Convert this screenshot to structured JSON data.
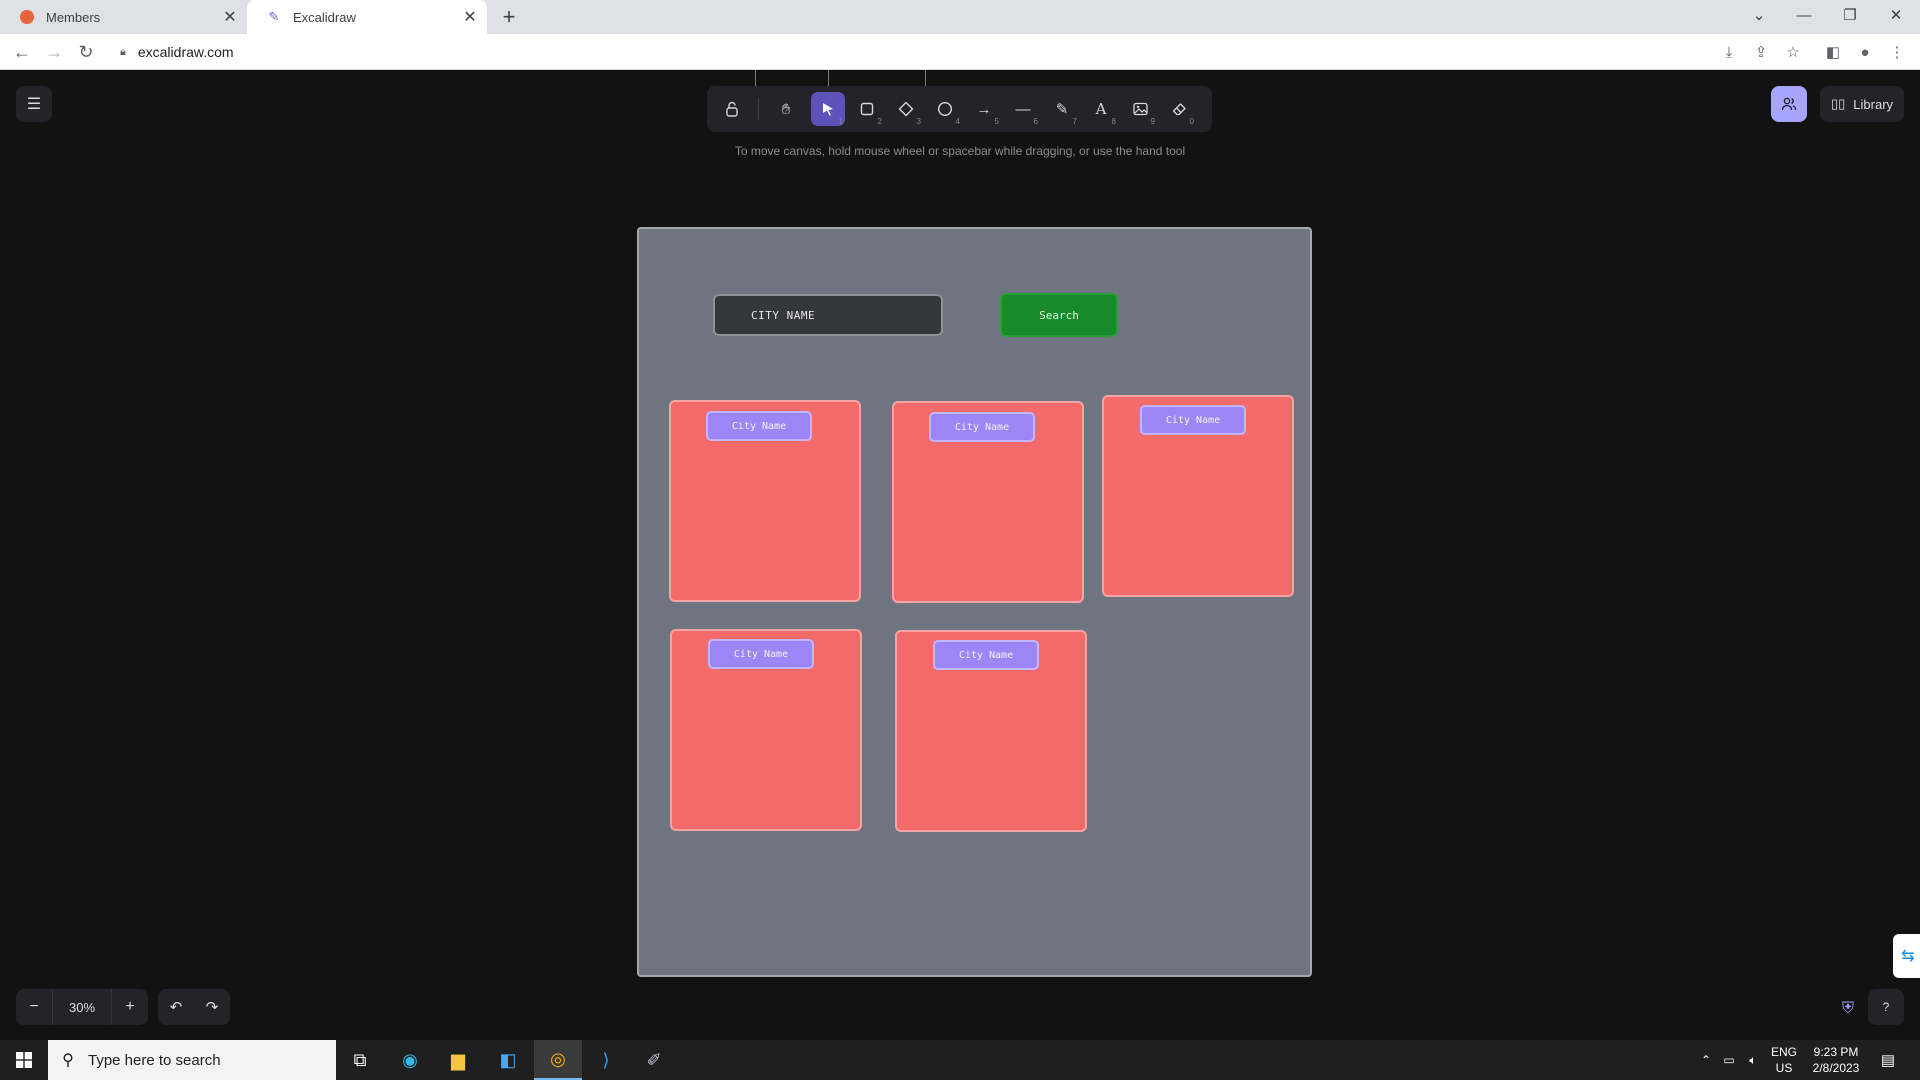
{
  "browser": {
    "tabs": [
      {
        "title": "Members",
        "favicon": "red-cloud-icon",
        "active": false
      },
      {
        "title": "Excalidraw",
        "favicon": "excalidraw-icon",
        "active": true
      }
    ],
    "url": "excalidraw.com"
  },
  "excalidraw": {
    "toolbar": {
      "tools": [
        {
          "name": "lock",
          "icon": "lock-icon",
          "key": ""
        },
        {
          "name": "hand",
          "icon": "hand-icon",
          "key": ""
        },
        {
          "name": "selection",
          "icon": "pointer-icon",
          "key": "1",
          "active": true
        },
        {
          "name": "rectangle",
          "icon": "rectangle-icon",
          "key": "2"
        },
        {
          "name": "diamond",
          "icon": "diamond-icon",
          "key": "3"
        },
        {
          "name": "ellipse",
          "icon": "ellipse-icon",
          "key": "4"
        },
        {
          "name": "arrow",
          "icon": "arrow-icon",
          "key": "5"
        },
        {
          "name": "line",
          "icon": "line-icon",
          "key": "6"
        },
        {
          "name": "draw",
          "icon": "pencil-icon",
          "key": "7"
        },
        {
          "name": "text",
          "icon": "text-icon",
          "key": "8"
        },
        {
          "name": "image",
          "icon": "image-icon",
          "key": "9"
        },
        {
          "name": "eraser",
          "icon": "eraser-icon",
          "key": "0"
        }
      ]
    },
    "hint": "To move canvas, hold mouse wheel or spacebar while dragging, or use the hand tool",
    "library_label": "Library",
    "zoom": "30%",
    "canvas": {
      "input_text": "CITY NAME",
      "search_label": "Search",
      "cards": [
        {
          "label": "City Name"
        },
        {
          "label": "City Name"
        },
        {
          "label": "City Name"
        },
        {
          "label": "City Name"
        },
        {
          "label": "City Name"
        }
      ],
      "colors": {
        "frame": "#6e7580",
        "card": "#f26a6a",
        "label": "#9c86f5",
        "search": "#178a2a",
        "input": "#35373b"
      }
    }
  },
  "taskbar": {
    "search_placeholder": "Type here to search",
    "lang_line1": "ENG",
    "lang_line2": "US",
    "time": "9:23 PM",
    "date": "2/8/2023"
  }
}
